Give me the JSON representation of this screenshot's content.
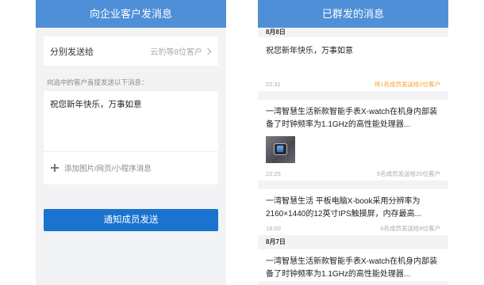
{
  "left": {
    "title": "向企业客户发消息",
    "group_label": "分别发送给",
    "group_value": "云豹等8位客户",
    "hint": "向选中的客户直接发送以下消息：",
    "message": "祝您新年快乐，万事如意",
    "attach_label": "添加图片/网页/小程序消息",
    "send_button": "通知成员发送"
  },
  "right": {
    "title": "已群发的消息",
    "sections": [
      {
        "date": "8月8日",
        "entries": [
          {
            "text": "祝您新年快乐，万事如意",
            "time": "22:31",
            "status": "待1名成员发送给2位客户",
            "status_color": "#f3a32a",
            "has_thumb": false
          },
          {
            "text": "一湾智慧生活新款智能手表X-watch在机身内部装备了时钟频率为1.1GHz的高性能处理器...",
            "time": "22:25",
            "status": "5名成员发送给20位客户",
            "status_color": "#aaaaaa",
            "has_thumb": true
          },
          {
            "text": "一湾智慧生活 平板电脑X-book采用分辨率为2160×1440的12英寸IPS触摸屏，内存最高...",
            "time": "18:00",
            "status": "3名成员发送给9位客户",
            "status_color": "#aaaaaa",
            "has_thumb": false
          }
        ]
      },
      {
        "date": "8月7日",
        "entries": [
          {
            "text": "一湾智慧生活新款智能手表X-watch在机身内部装备了时钟频率为1.1GHz的高性能处理器...",
            "time": "",
            "status": "",
            "status_color": "#aaaaaa",
            "has_thumb": false
          }
        ]
      }
    ]
  },
  "icons": {
    "chevron": "chevron-right-icon",
    "plus": "plus-icon",
    "thumbnail": "smartwatch-thumbnail"
  },
  "colors": {
    "header_blue": "#4f8fd7",
    "button_blue": "#1a73cf",
    "pending_orange": "#f3a32a"
  }
}
